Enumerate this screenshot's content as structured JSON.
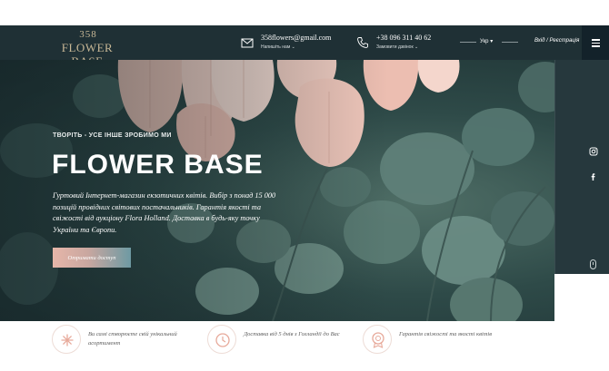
{
  "header": {
    "logo_number": "358",
    "logo_name": "FLOWER BASE",
    "email": "358flowers@gmail.com",
    "email_sub": "Напишіть нам",
    "phone": "+38 096 311 40 62",
    "phone_sub": "Замовити дзвінок",
    "language": "Укр",
    "login": "Вхід / Реєстрація"
  },
  "hero": {
    "tagline": "ТВОРІТЬ - УСЕ ІНШЕ ЗРОБИМО МИ",
    "title": "FLOWER BASE",
    "description": "Гуртовий Інтернет-магазин екзотичних квітів. Вибір з понад 15 000 позицій провідних світових постачальників. Гарантія якості та свіжості від аукціону Flora Holland. Доставка в будь-яку точку України та Європи.",
    "cta_label": "Отримати доступ"
  },
  "social": [
    "instagram-icon",
    "facebook-icon"
  ],
  "features": [
    {
      "icon": "flower-icon",
      "text": "Ви самі створюєте свій унікальний асортимент"
    },
    {
      "icon": "clock-icon",
      "text": "Доставка від 5 днів з Голландії до Вас"
    },
    {
      "icon": "quality-badge-icon",
      "text": "Гарантія свіжості та якості квітів"
    }
  ],
  "colors": {
    "header_bg": "#1f3035",
    "logo_gold": "#c8b896",
    "rail_bg": "#26383d",
    "cta_start": "#e6b6a9",
    "cta_end": "#6e9aa3",
    "feature_icon": "#e7a99a"
  }
}
